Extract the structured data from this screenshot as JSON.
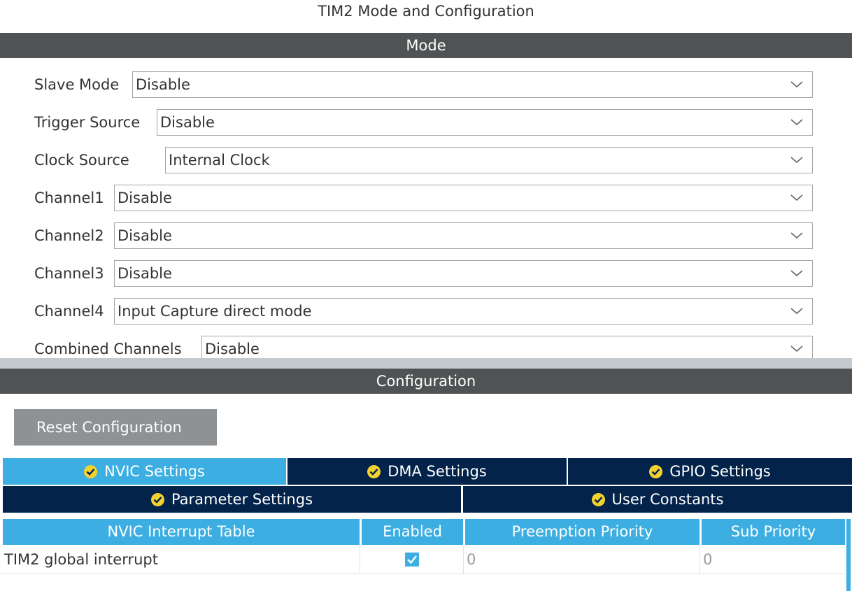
{
  "window": {
    "title": "TIM2 Mode and Configuration"
  },
  "mode_section": {
    "header": "Mode",
    "fields": [
      {
        "label": "Slave Mode",
        "value": "Disable"
      },
      {
        "label": "Trigger Source",
        "value": "Disable"
      },
      {
        "label": "Clock Source",
        "value": "Internal Clock"
      },
      {
        "label": "Channel1",
        "value": "Disable"
      },
      {
        "label": "Channel2",
        "value": "Disable"
      },
      {
        "label": "Channel3",
        "value": "Disable"
      },
      {
        "label": "Channel4",
        "value": "Input Capture direct mode"
      },
      {
        "label": "Combined Channels",
        "value": "Disable"
      }
    ]
  },
  "config_section": {
    "header": "Configuration",
    "reset_button": "Reset Configuration",
    "tabs_row1": [
      {
        "label": "NVIC Settings",
        "active": true
      },
      {
        "label": "DMA Settings",
        "active": false
      },
      {
        "label": "GPIO Settings",
        "active": false
      }
    ],
    "tabs_row2": [
      {
        "label": "Parameter Settings",
        "active": false
      },
      {
        "label": "User Constants",
        "active": false
      }
    ]
  },
  "nvic_table": {
    "columns": [
      "NVIC Interrupt Table",
      "Enabled",
      "Preemption Priority",
      "Sub Priority"
    ],
    "rows": [
      {
        "name": "TIM2 global interrupt",
        "enabled": true,
        "preemption": "0",
        "sub": "0"
      }
    ]
  },
  "colors": {
    "header_bar": "#4f5354",
    "tab_active": "#3caee2",
    "tab_inactive": "#03234b",
    "check_badge": "#f3d22f",
    "button_gray": "#8e9294"
  },
  "icons": {
    "dropdown": "chevron-down-icon",
    "tab_status": "check-circle-icon",
    "checkbox": "checkbox-checked-icon"
  }
}
